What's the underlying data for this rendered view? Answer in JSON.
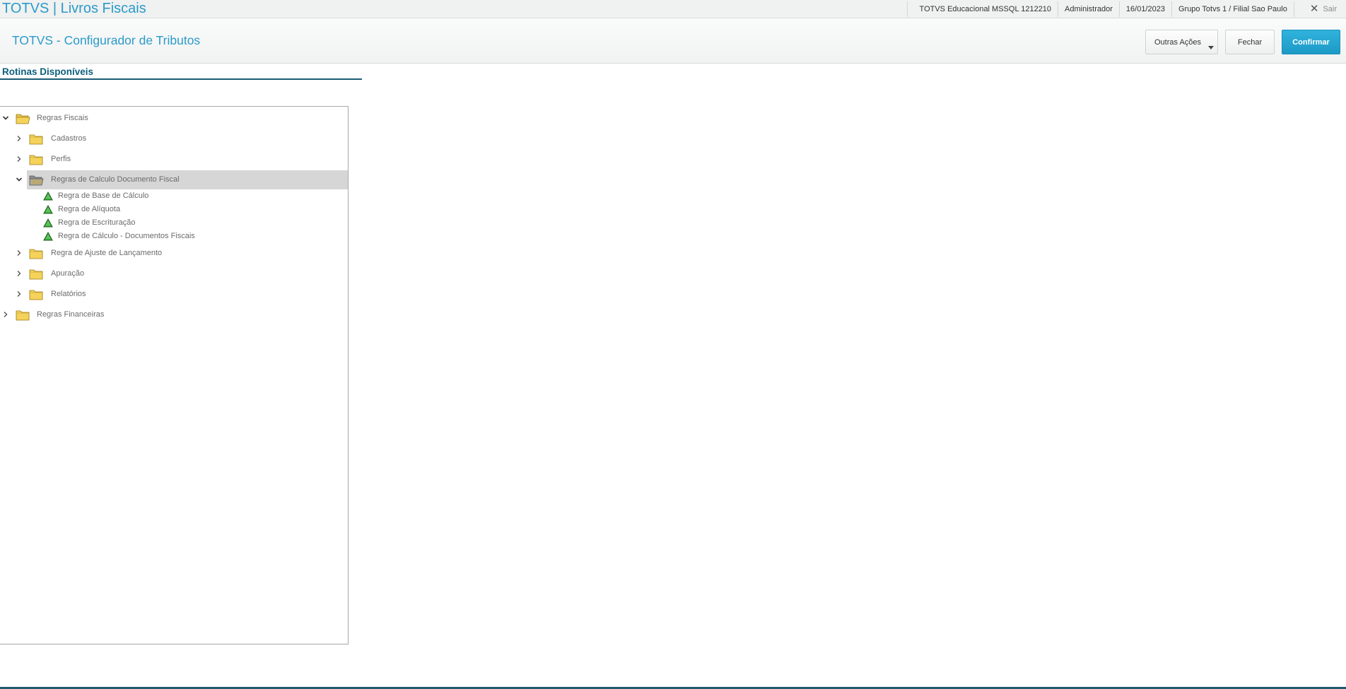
{
  "topbar": {
    "app_title": "TOTVS | Livros Fiscais",
    "environment": "TOTVS Educacional MSSQL 1212210",
    "user": "Administrador",
    "date": "16/01/2023",
    "branch": "Grupo Totvs 1 / Filial Sao Paulo",
    "logout_label": "Sair"
  },
  "header": {
    "title": "TOTVS - Configurador de Tributos",
    "other_actions_label": "Outras Ações",
    "close_label": "Fechar",
    "confirm_label": "Confirmar"
  },
  "section": {
    "title": "Rotinas Disponíveis"
  },
  "tree": {
    "regras_fiscais": "Regras Fiscais",
    "cadastros": "Cadastros",
    "perfis": "Perfis",
    "regras_calculo_doc": "Regras de Calculo Documento Fiscal",
    "leaf_base_calculo": "Regra de Base de Cálculo",
    "leaf_aliquota": "Regra de Alíquota",
    "leaf_escrituracao": "Regra de Escrituração",
    "leaf_calculo_docs": "Regra de Cálculo - Documentos Fiscais",
    "ajuste_lancamento": "Regra de Ajuste de Lançamento",
    "apuracao": "Apuração",
    "relatorios": "Relatórios",
    "regras_financeiras": "Regras Financeiras"
  },
  "colors": {
    "brand_blue": "#2a9bc9",
    "section_navy": "#0c5f7d",
    "confirm_button": "#1d9ac7",
    "folder_yellow": "#f5d35a",
    "leaf_green": "#2e8b2e"
  }
}
